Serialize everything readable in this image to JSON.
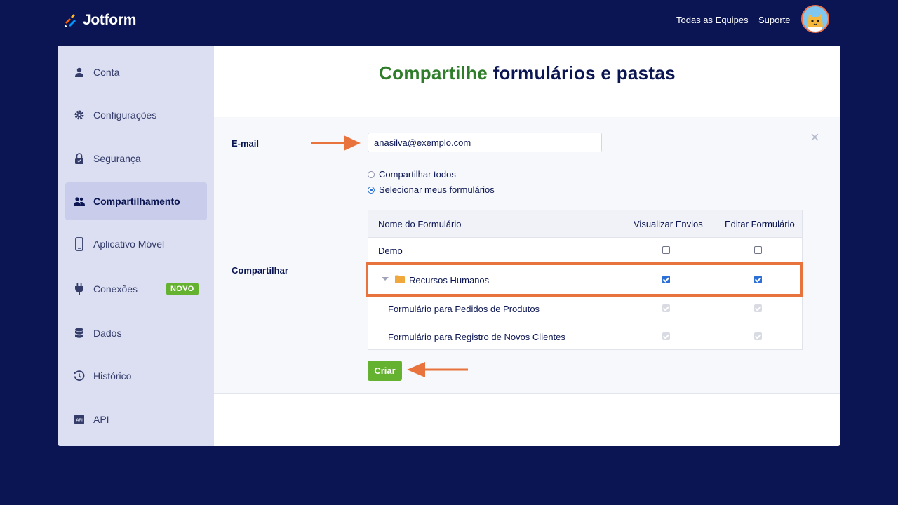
{
  "topbar": {
    "logo_text": "Jotform",
    "links": [
      "Todas as Equipes",
      "Suporte"
    ]
  },
  "sidebar": {
    "items": [
      {
        "label": "Conta",
        "icon": "user-icon"
      },
      {
        "label": "Configurações",
        "icon": "gear-icon"
      },
      {
        "label": "Segurança",
        "icon": "lock-icon"
      },
      {
        "label": "Compartilhamento",
        "icon": "users-icon",
        "active": true
      },
      {
        "label": "Aplicativo Móvel",
        "icon": "phone-icon"
      },
      {
        "label": "Conexões",
        "icon": "plug-icon",
        "badge": "NOVO"
      },
      {
        "label": "Dados",
        "icon": "database-icon"
      },
      {
        "label": "Histórico",
        "icon": "history-icon"
      },
      {
        "label": "API",
        "icon": "api-icon"
      }
    ]
  },
  "main": {
    "title_accent": "Compartilhe",
    "title_rest": " formulários e pastas",
    "email_label": "E-mail",
    "email_value": "anasilva@exemplo.com",
    "share_label": "Compartilhar",
    "radios": [
      {
        "label": "Compartilhar todos",
        "checked": false
      },
      {
        "label": "Selecionar meus formulários",
        "checked": true
      }
    ],
    "table": {
      "headers": [
        "Nome do Formulário",
        "Visualizar Envios",
        "Editar Formulário"
      ],
      "rows": [
        {
          "name": "Demo",
          "view": "unchecked",
          "edit": "unchecked"
        },
        {
          "name": "Recursos Humanos",
          "view": "checked",
          "edit": "checked",
          "folder": true
        },
        {
          "name": "Formulário para Pedidos de Produtos",
          "view": "checked-disabled",
          "edit": "checked-disabled"
        },
        {
          "name": "Formulário para Registro de Novos Clientes",
          "view": "checked-disabled",
          "edit": "checked-disabled"
        }
      ]
    },
    "create_button": "Criar",
    "close_symbol": "×"
  },
  "colors": {
    "background": "#0b1553",
    "accent_green": "#64b22f",
    "title_green": "#2f7d2a",
    "annotation_orange": "#e8733c",
    "checkbox_blue": "#2c6fd6"
  }
}
